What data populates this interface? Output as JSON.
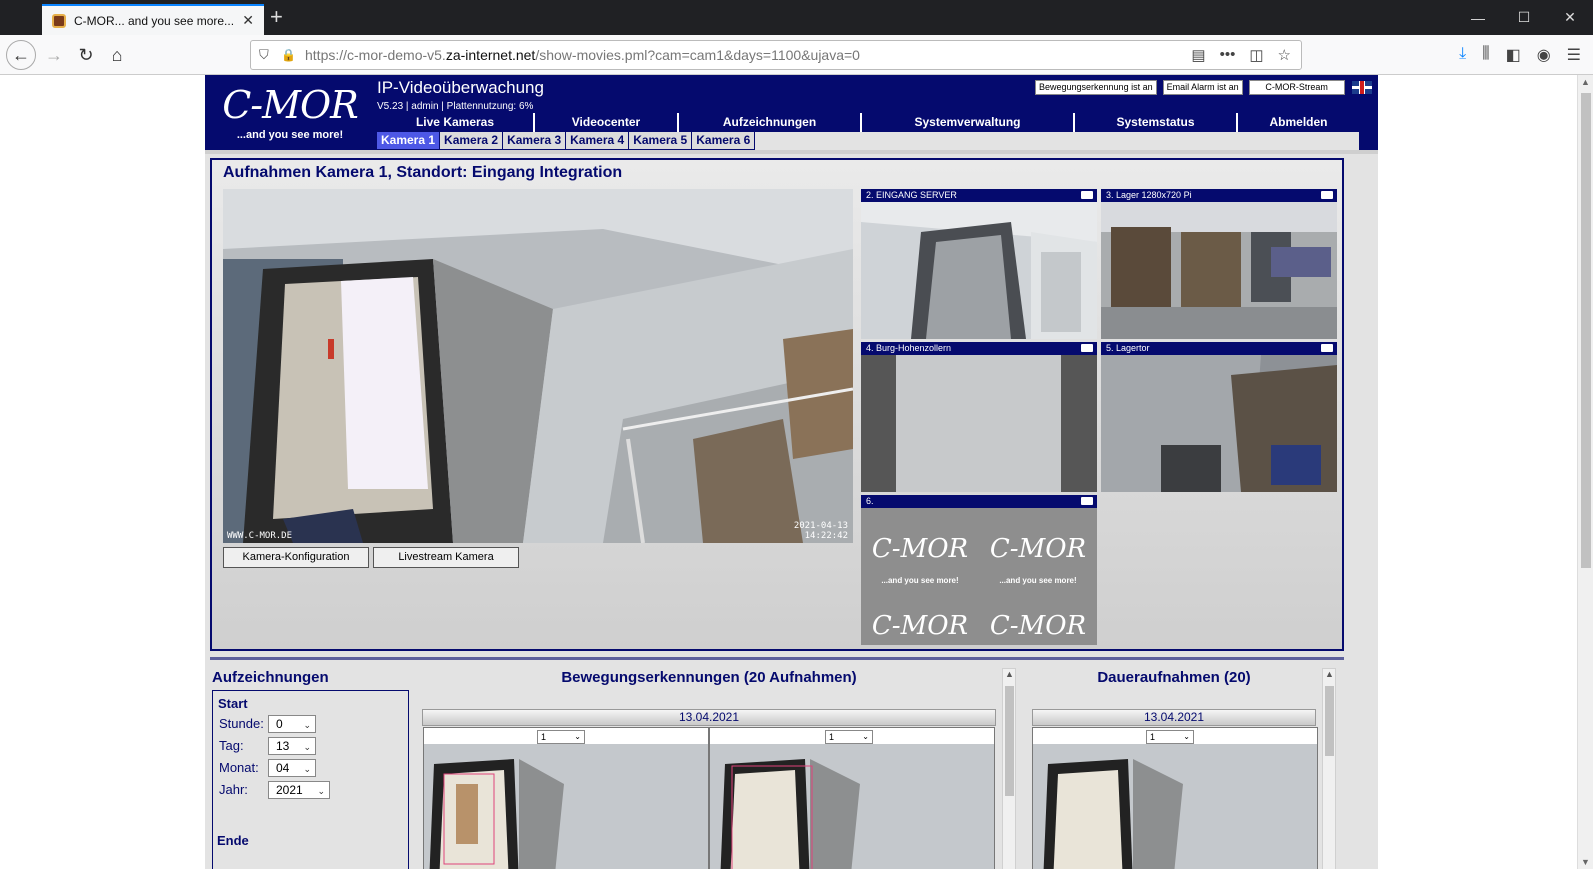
{
  "browser": {
    "tab_title": "C-MOR... and you see more...",
    "tab_close": "✕",
    "new_tab": "+",
    "url_prefix": "https://c-mor-demo-v5.",
    "url_domain": "za-internet.net",
    "url_path": "/show-movies.pml?cam=cam1&days=1100&ujava=0",
    "window_minimize": "—",
    "window_maximize": "☐",
    "window_close": "✕"
  },
  "header": {
    "logo_text": "C-MOR",
    "logo_tagline": "...and you see more!",
    "app_title": "IP-Videoüberwachung",
    "app_subtitle": "V5.23 | admin | Plattennutzung: 6%",
    "motion_button": "Bewegungserkennung ist an",
    "email_button": "Email Alarm ist an",
    "stream_button": "C-MOR-Stream"
  },
  "main_nav": [
    {
      "label": "Live Kameras"
    },
    {
      "label": "Videocenter"
    },
    {
      "label": "Aufzeichnungen"
    },
    {
      "label": "Systemverwaltung"
    },
    {
      "label": "Systemstatus"
    },
    {
      "label": "Abmelden"
    }
  ],
  "camera_tabs": [
    {
      "label": "Kamera 1",
      "active": true
    },
    {
      "label": "Kamera 2"
    },
    {
      "label": "Kamera 3"
    },
    {
      "label": "Kamera 4"
    },
    {
      "label": "Kamera 5"
    },
    {
      "label": "Kamera 6"
    }
  ],
  "recording_panel": {
    "title": "Aufnahmen Kamera 1, Standort: Eingang Integration",
    "watermark": "WWW.C-MOR.DE",
    "timestamp_date": "2021-04-13",
    "timestamp_time": "14:22:42",
    "config_button": "Kamera-Konfiguration",
    "livestream_button": "Livestream Kamera"
  },
  "thumbnails": [
    {
      "label": "2. EINGANG SERVER"
    },
    {
      "label": "3. Lager 1280x720 Pi"
    },
    {
      "label": "4. Burg-Hohenzollern"
    },
    {
      "label": "5. Lagertor"
    },
    {
      "label": "6."
    }
  ],
  "recordings": {
    "title": "Aufzeichnungen",
    "start_label": "Start",
    "end_label": "Ende",
    "fields": [
      {
        "label": "Stunde:",
        "value": "0"
      },
      {
        "label": "Tag:",
        "value": "13"
      },
      {
        "label": "Monat:",
        "value": "04"
      },
      {
        "label": "Jahr:",
        "value": "2021"
      }
    ],
    "motion_title": "Bewegungserkennungen (20 Aufnahmen)",
    "continuous_title": "Daueraufnahmen (20)",
    "motion_date": "13.04.2021",
    "continuous_date": "13.04.2021",
    "clip_select_value": "1"
  }
}
